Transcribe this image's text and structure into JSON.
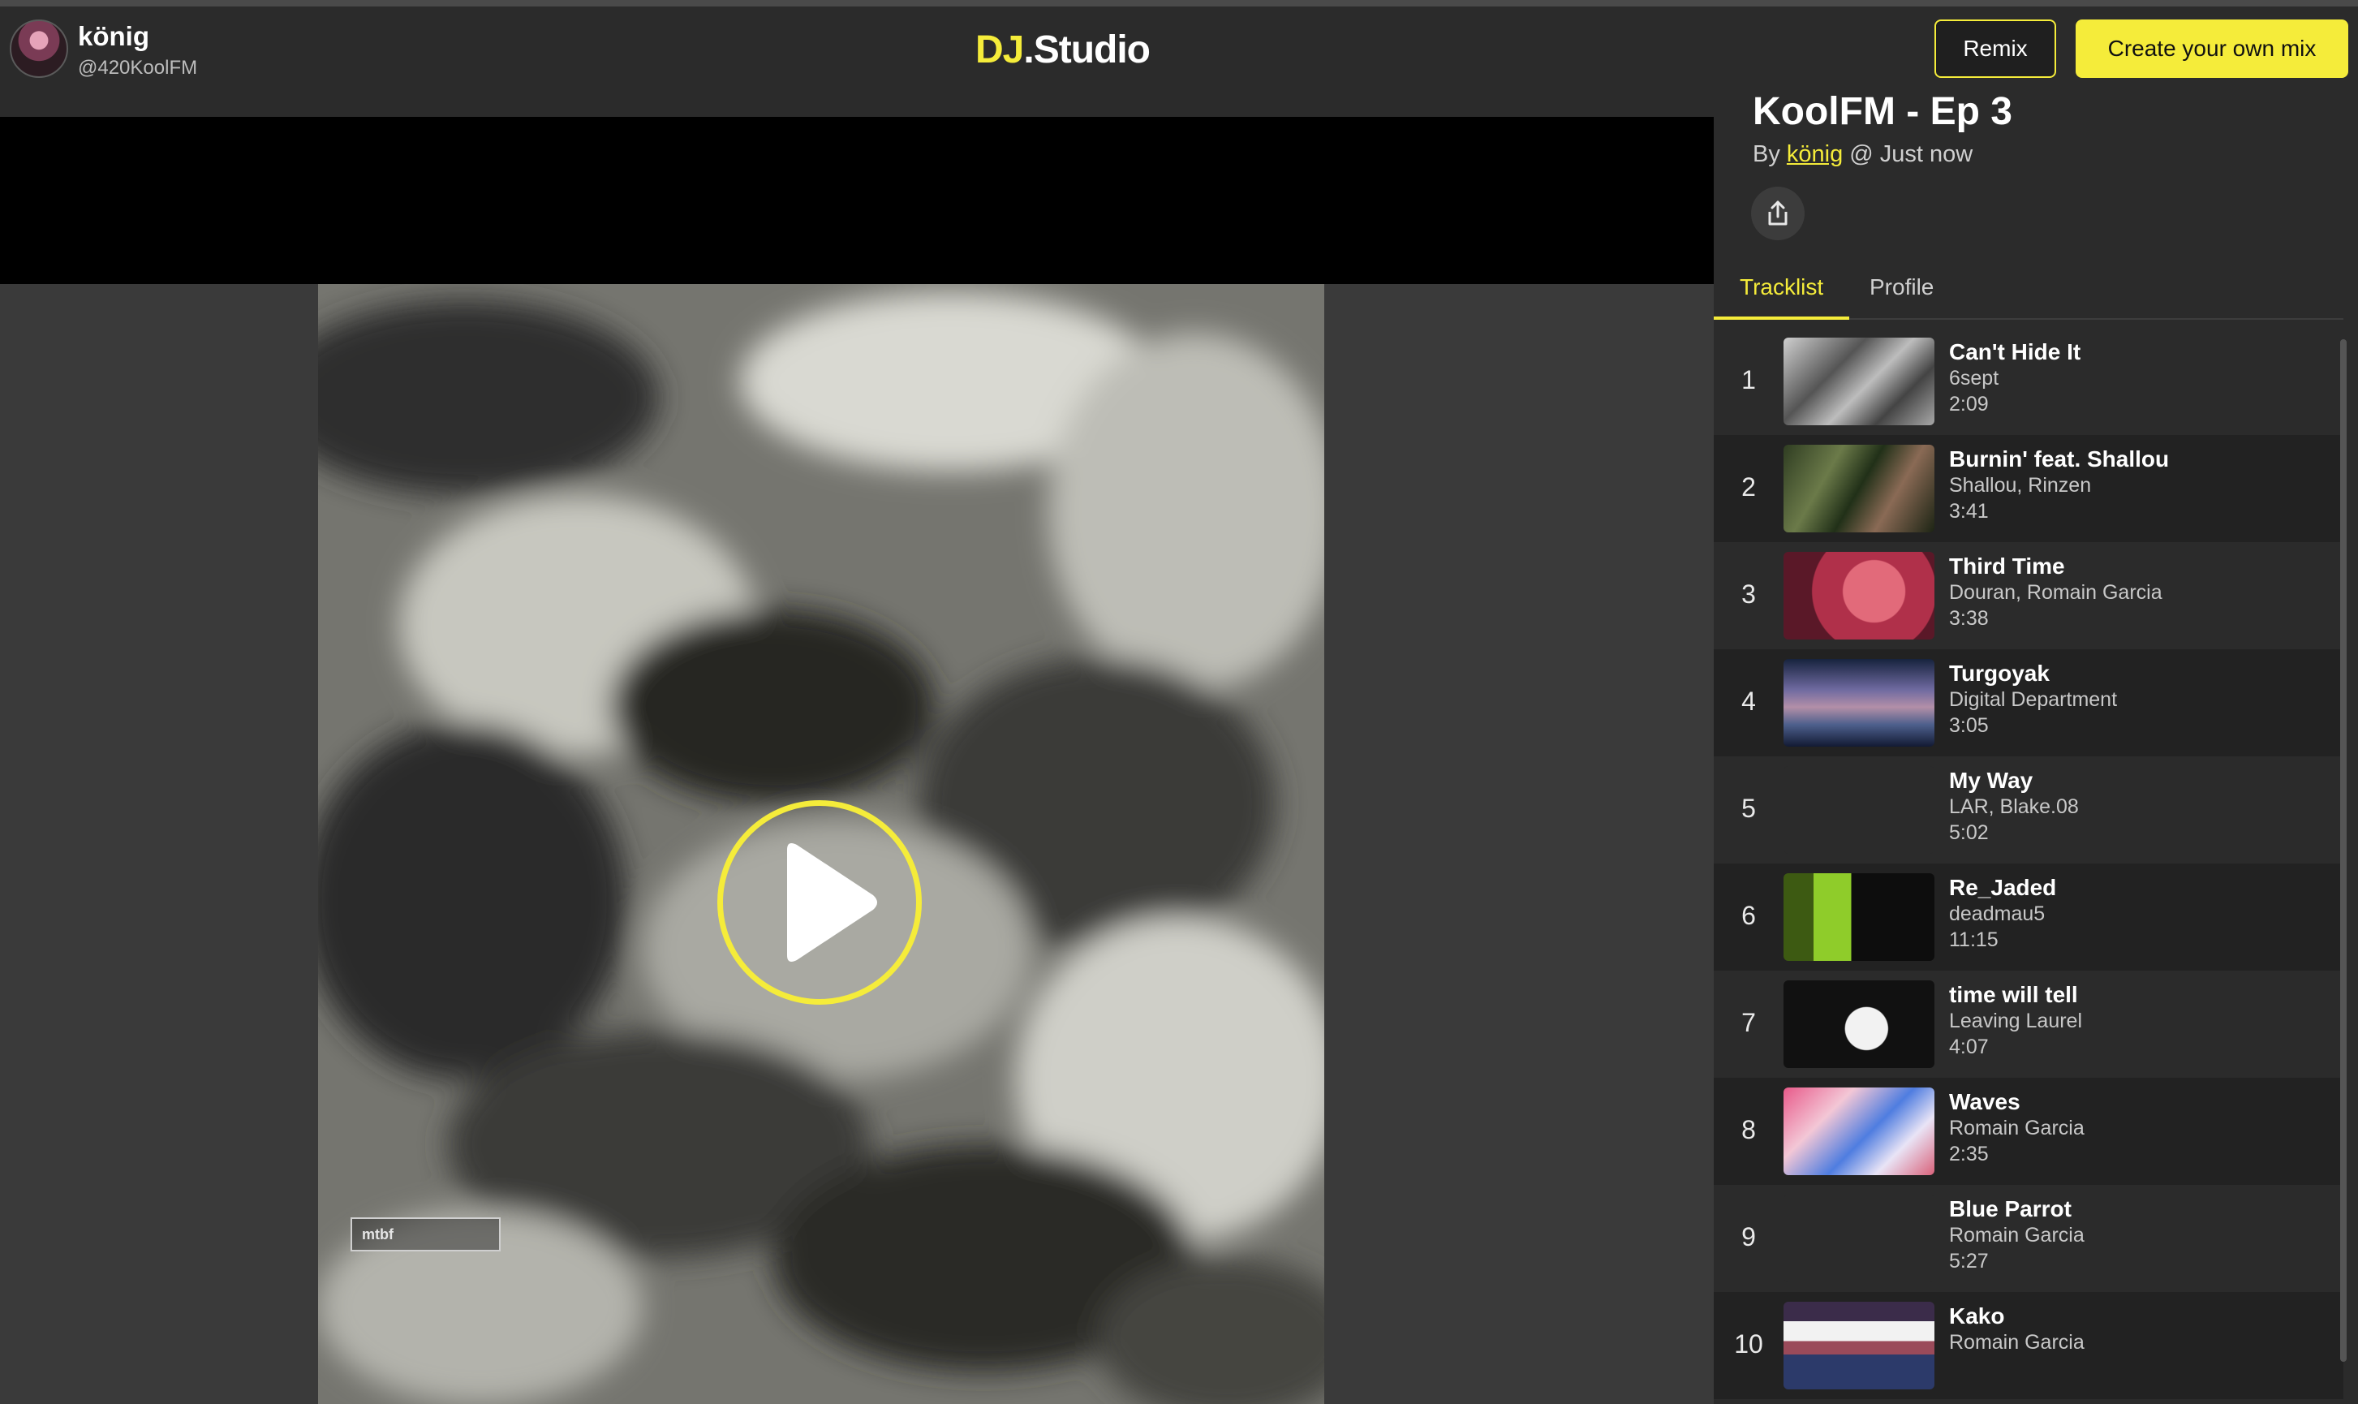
{
  "header": {
    "user_name": "könig",
    "user_handle": "@420KoolFM",
    "logo_dj": "DJ",
    "logo_studio": ".Studio",
    "remix_label": "Remix",
    "create_label": "Create your own mix"
  },
  "video": {
    "cover_badge": "mtbf"
  },
  "mix": {
    "title": "KoolFM - Ep 3",
    "by_prefix": "By ",
    "by_user": "könig",
    "by_suffix": " @ Just now"
  },
  "tabs": {
    "tracklist": "Tracklist",
    "profile": "Profile"
  },
  "tracks": [
    {
      "num": "1",
      "title": "Can't Hide It",
      "artist": "6sept",
      "duration": "2:09"
    },
    {
      "num": "2",
      "title": "Burnin' feat. Shallou",
      "artist": "Shallou, Rinzen",
      "duration": "3:41"
    },
    {
      "num": "3",
      "title": "Third Time",
      "artist": "Douran, Romain Garcia",
      "duration": "3:38"
    },
    {
      "num": "4",
      "title": "Turgoyak",
      "artist": "Digital Department",
      "duration": "3:05"
    },
    {
      "num": "5",
      "title": "My Way",
      "artist": "LAR, Blake.08",
      "duration": "5:02"
    },
    {
      "num": "6",
      "title": "Re_Jaded",
      "artist": "deadmau5",
      "duration": "11:15"
    },
    {
      "num": "7",
      "title": "time will tell",
      "artist": "Leaving Laurel",
      "duration": "4:07"
    },
    {
      "num": "8",
      "title": "Waves",
      "artist": "Romain Garcia",
      "duration": "2:35"
    },
    {
      "num": "9",
      "title": "Blue Parrot",
      "artist": "Romain Garcia",
      "duration": "5:27"
    },
    {
      "num": "10",
      "title": "Kako",
      "artist": "Romain Garcia",
      "duration": ""
    }
  ],
  "colors": {
    "accent": "#f5ec3a",
    "background": "#2b2b2b",
    "video_bg": "#000000"
  }
}
